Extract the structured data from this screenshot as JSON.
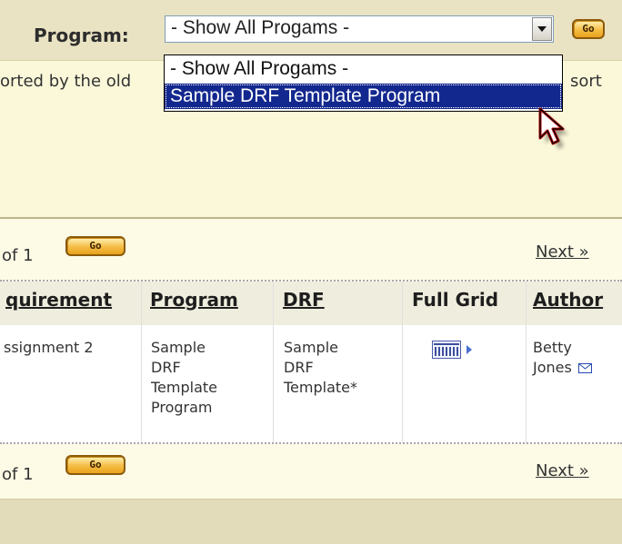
{
  "filter": {
    "label": "Program:",
    "selected": "- Show All Progams -",
    "go": "Go"
  },
  "dropdown": {
    "options": [
      "- Show All Progams -",
      "Sample DRF Template Program"
    ]
  },
  "info": {
    "text": "orted by the old",
    "text_right": "sort"
  },
  "pager": {
    "of": "of 1",
    "go": "Go",
    "next": "Next",
    "next_arrow": "»"
  },
  "table": {
    "headers": [
      "quirement",
      "Program",
      "DRF",
      "Full Grid",
      "Author"
    ],
    "row": {
      "requirement": "ssignment 2",
      "program": [
        "Sample",
        "DRF",
        "Template",
        "Program"
      ],
      "drf": [
        "Sample",
        "DRF",
        "Template*"
      ],
      "author": [
        "Betty",
        "Jones"
      ]
    }
  },
  "icons": [
    "dropdown-arrow-icon",
    "grid-icon",
    "play-arrow-icon",
    "email-icon",
    "mouse-pointer-icon"
  ],
  "colors": {
    "filter_bg": "#e9e3c3",
    "info_bg": "#fbf8d9",
    "selected_option": "#13288f",
    "go_button": "#f5bd44"
  }
}
